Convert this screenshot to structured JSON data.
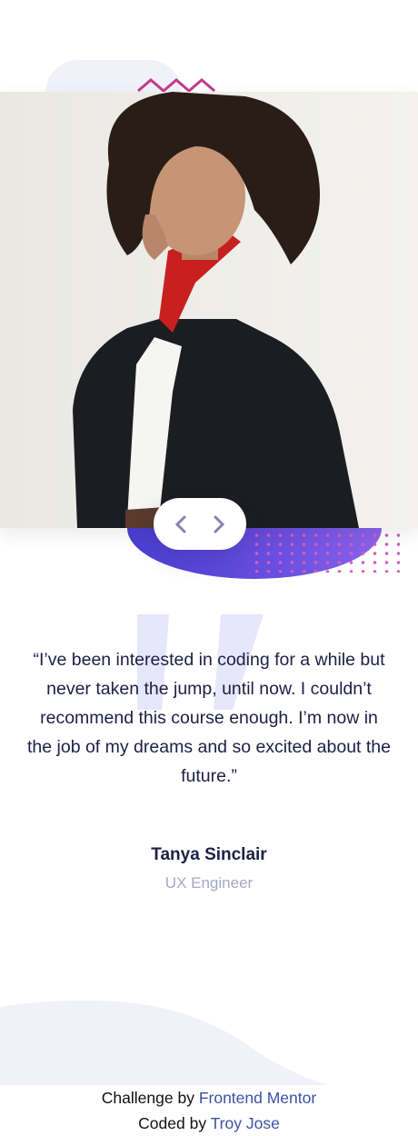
{
  "testimonial": {
    "quote": "“I’ve been interested in coding for a while but never taken the jump, until now. I couldn’t recommend this course enough. I’m now in the job of my dreams and so excited about the future.”",
    "name": "Tanya Sinclair",
    "role": "UX Engineer",
    "photo_icon": "portrait-photo"
  },
  "nav": {
    "prev_icon": "chevron-left-icon",
    "next_icon": "chevron-right-icon"
  },
  "footer": {
    "challenge_prefix": "Challenge by",
    "challenge_link": "Frontend Mentor",
    "coded_prefix": "Coded by",
    "coded_link": "Troy Jose"
  },
  "colors": {
    "accent_purple": "#4b3fd4",
    "dots_pink": "#d35ec0",
    "text_dark": "#202046",
    "text_muted": "#a7a7c6",
    "link_blue": "#3e52a3"
  }
}
